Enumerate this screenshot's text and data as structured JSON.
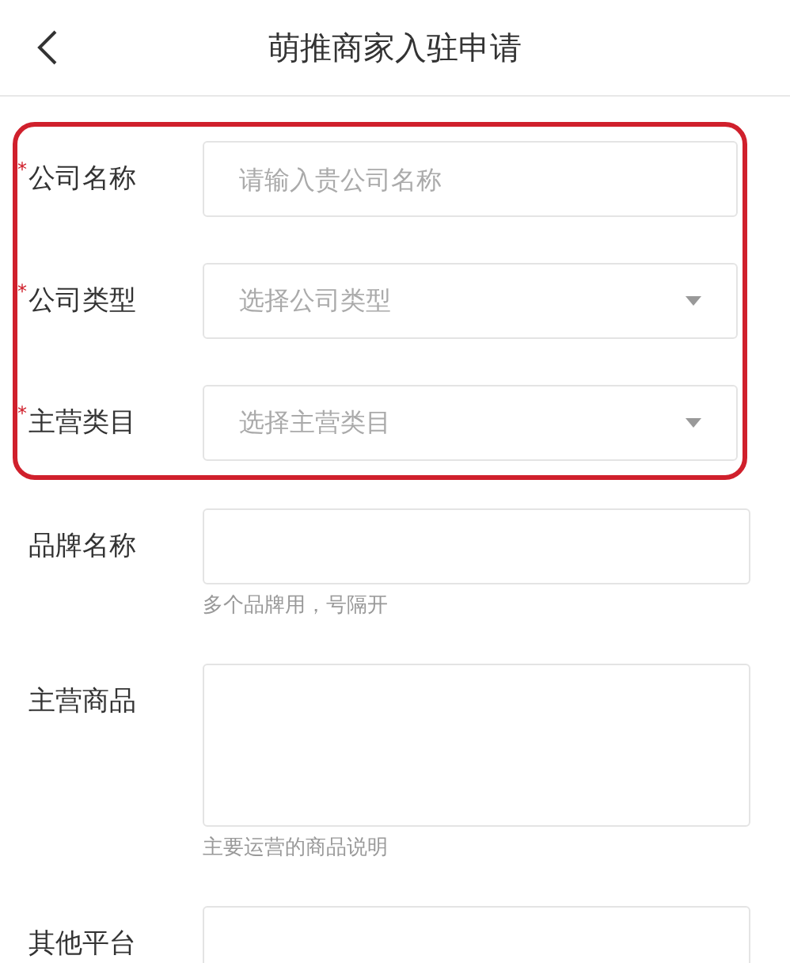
{
  "header": {
    "title": "萌推商家入驻申请"
  },
  "highlighted_fields": [
    {
      "mark": "*",
      "label": "公司名称",
      "kind": "text",
      "placeholder": "请输入贵公司名称"
    },
    {
      "mark": "*",
      "label": "公司类型",
      "kind": "select",
      "placeholder": "选择公司类型"
    },
    {
      "mark": "*",
      "label": "主营类目",
      "kind": "select",
      "placeholder": "选择主营类目"
    }
  ],
  "fields": [
    {
      "label": "品牌名称",
      "kind": "text",
      "hint": "多个品牌用，号隔开"
    },
    {
      "label": "主营商品",
      "kind": "textarea",
      "hint": "主要运营的商品说明"
    },
    {
      "label": "其他平台",
      "kind": "text"
    }
  ]
}
